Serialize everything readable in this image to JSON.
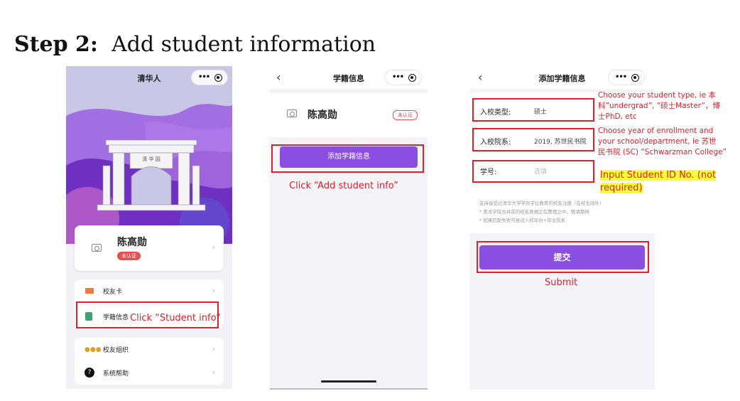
{
  "heading": {
    "step": "Step 2:",
    "text": "Add student information"
  },
  "colors": {
    "accent": "#8a4fe0",
    "annotation": "#e0202a",
    "highlight": "#ffff33"
  },
  "phone1": {
    "nav_title": "清华人",
    "profile": {
      "name": "陈高勋",
      "badge": "未认证"
    },
    "menu": [
      {
        "icon": "alumni-card-icon",
        "label": "校友卡"
      },
      {
        "icon": "student-info-icon",
        "label": "学籍信息"
      },
      {
        "icon": "alumni-group-icon",
        "label": "校友组织"
      },
      {
        "icon": "help-icon",
        "label": "系统帮助"
      }
    ],
    "annotation": "Click “Student info”"
  },
  "phone2": {
    "nav_title": "学籍信息",
    "profile": {
      "name": "陈高勋",
      "badge": "未认证"
    },
    "add_button": "添加学籍信息",
    "annotation": "Click “Add student info”"
  },
  "phone3": {
    "nav_title": "添加学籍信息",
    "fields": [
      {
        "label": "入校类型:",
        "value": "硕士"
      },
      {
        "label": "入校院系:",
        "value": "2019, 苏世民书院"
      },
      {
        "label": "学号:",
        "value": "选填"
      }
    ],
    "notes": [
      "支持接受过清华大学学历学位教育的校友注册（在校生除外）",
      "* 美术学院合并前的校友数据正在整理之中，敬请期待",
      "* 如果匹配失败可尝试入校年份+毕业院系"
    ],
    "submit_button": "提交",
    "annotations": {
      "type_line1": "Choose your student type, ie 本",
      "type_line2": "科”undergrad”, “硕士Master”，博",
      "type_line3": "士PhD, etc",
      "year_line1": "Choose year of enrollment and",
      "year_line2": "your school/department, ie 苏世",
      "year_line3": "民书院 (SC) “Schwarzman College”",
      "id_line1": "Input Student ID No. (not",
      "id_line2": "required)",
      "submit": "Submit"
    }
  }
}
